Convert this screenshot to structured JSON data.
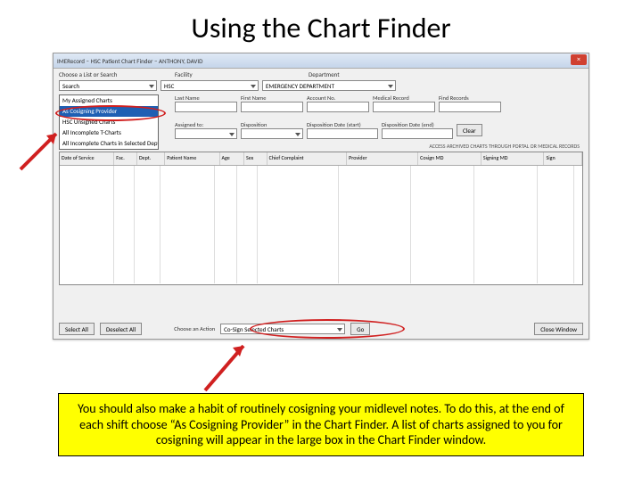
{
  "slide": {
    "title": "Using the Chart Finder"
  },
  "window": {
    "title": "IMERecord – HSC Patient Chart Finder – ANTHONY, DAVID",
    "close": "×"
  },
  "sections": {
    "choose": "Choose a List or Search",
    "facility": "Facility",
    "department": "Department"
  },
  "top": {
    "search": "Search",
    "facility_val": "HSC",
    "department_val": "EMERGENCY DEPARTMENT"
  },
  "dropdown": {
    "opt0": "My Assigned Charts",
    "opt1": "As Cosigning Provider",
    "opt2": "HSC Unsigned Charts",
    "opt3": "All Incomplete T-Charts",
    "opt4": "All Incomplete Charts in Selected Dept"
  },
  "fields": {
    "lastname": "Last Name",
    "firstname": "First Name",
    "account": "Account No.",
    "mrn": "Medical Record",
    "findrec": "Find Records",
    "assigned": "Assigned to:",
    "dossed": "Disposition",
    "dispstart": "Disposition Date (start)",
    "dispend": "Disposition Date (end)",
    "clear": "Clear"
  },
  "archived": "ACCESS ARCHIVED CHARTS THROUGH PORTAL OR MEDICAL RECORDS",
  "cols": {
    "c0": "Date of Service",
    "c1": "Fac.",
    "c2": "Dept.",
    "c3": "Patient Name",
    "c4": "Age",
    "c5": "Sex",
    "c6": "Chief Complaint",
    "c7": "Provider",
    "c8": "Cosign MD",
    "c9": "Signing MD",
    "c10": "Sign"
  },
  "bottom": {
    "selectall": "Select All",
    "deselectall": "Deselect All",
    "action_lbl": "Choose an Action",
    "action_val": "Co-Sign Selected Charts",
    "go": "Go",
    "close": "Close Window"
  },
  "caption": "You should also make a habit of routinely cosigning your midlevel notes. To do this, at the end of each shift choose “As Cosigning Provider” in the Chart Finder. A list of charts assigned to you for cosigning will appear in the large box in the Chart Finder window."
}
